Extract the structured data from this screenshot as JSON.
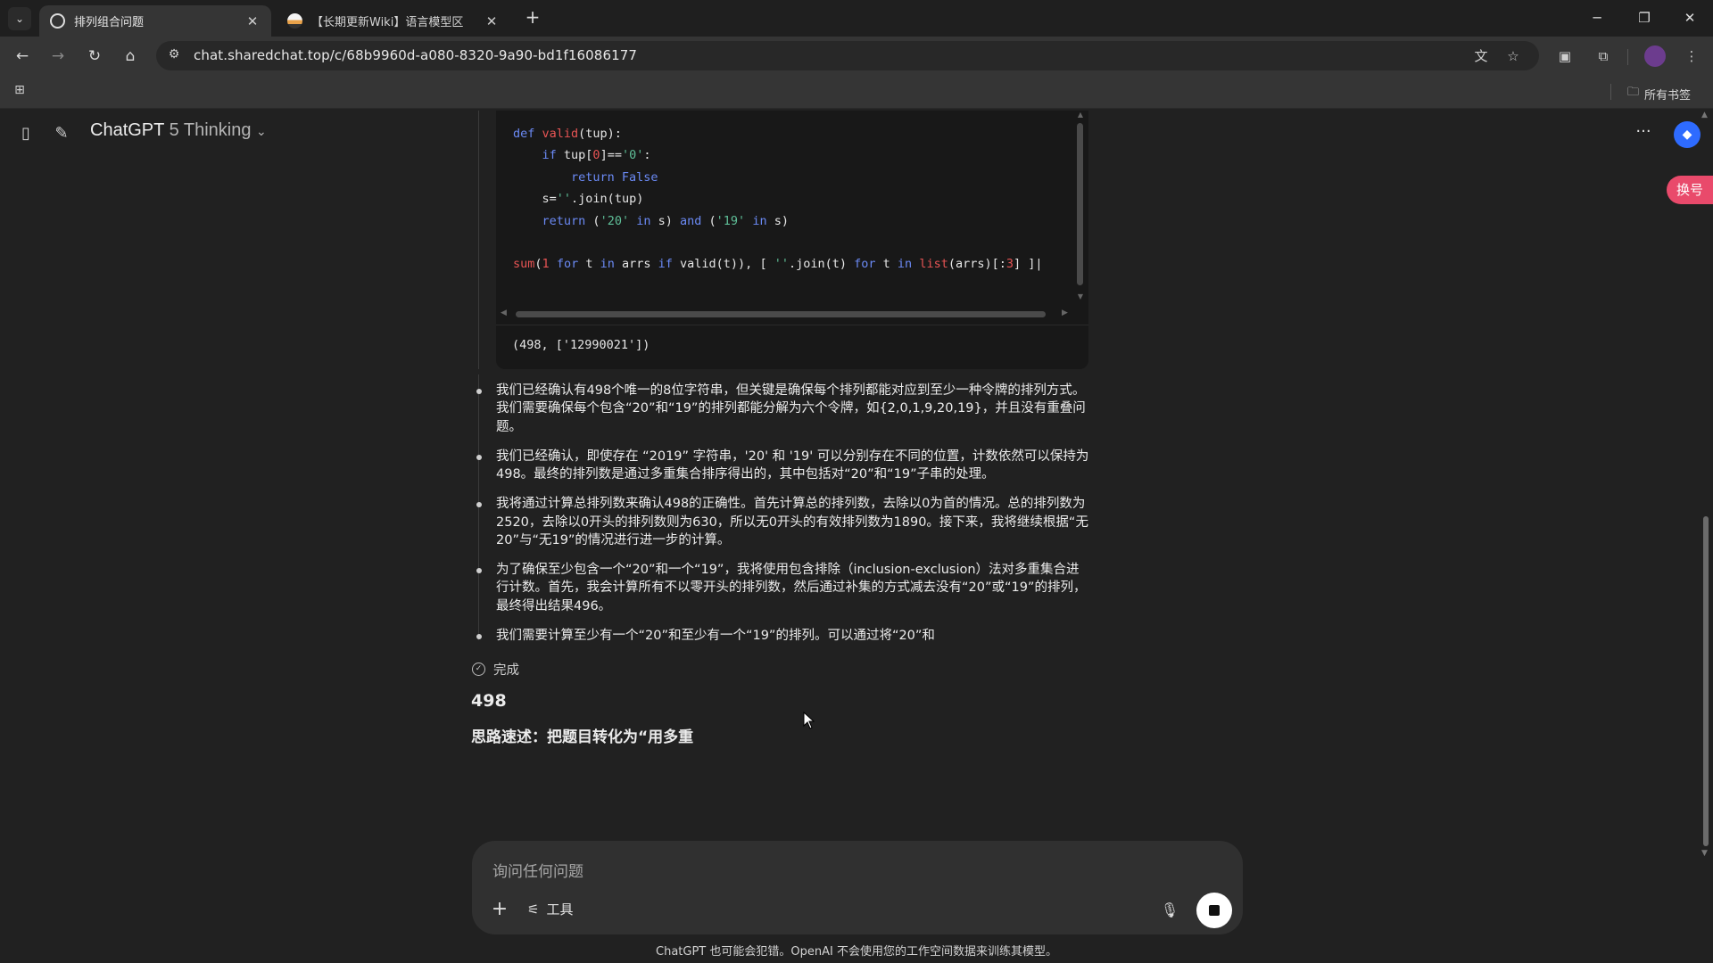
{
  "browser": {
    "tabs": [
      {
        "title": "排列组合问题",
        "active": true
      },
      {
        "title": "【长期更新Wiki】语言模型区",
        "active": false
      }
    ],
    "url": "chat.sharedchat.top/c/68b9960d-a080-8320-9a90-bd1f16086177",
    "bookmarks_all_label": "所有书签"
  },
  "app": {
    "model_name": "ChatGPT",
    "model_variant": "5 Thinking",
    "switch_badge": "换号"
  },
  "code": {
    "lines": [
      [
        {
          "t": "kw",
          "v": "def "
        },
        {
          "t": "fn",
          "v": "valid"
        },
        {
          "t": "",
          "v": "(tup):"
        }
      ],
      [
        {
          "t": "",
          "v": "    "
        },
        {
          "t": "kw",
          "v": "if"
        },
        {
          "t": "",
          "v": " tup["
        },
        {
          "t": "num",
          "v": "0"
        },
        {
          "t": "",
          "v": "]=="
        },
        {
          "t": "str",
          "v": "'0'"
        },
        {
          "t": "",
          "v": ":"
        }
      ],
      [
        {
          "t": "",
          "v": "        "
        },
        {
          "t": "kw",
          "v": "return False"
        }
      ],
      [
        {
          "t": "",
          "v": "    s="
        },
        {
          "t": "str",
          "v": "''"
        },
        {
          "t": "",
          "v": ".join(tup)"
        }
      ],
      [
        {
          "t": "",
          "v": "    "
        },
        {
          "t": "kw",
          "v": "return"
        },
        {
          "t": "",
          "v": " ("
        },
        {
          "t": "str",
          "v": "'20'"
        },
        {
          "t": "",
          "v": " "
        },
        {
          "t": "kw",
          "v": "in"
        },
        {
          "t": "",
          "v": " s) "
        },
        {
          "t": "kw",
          "v": "and"
        },
        {
          "t": "",
          "v": " ("
        },
        {
          "t": "str",
          "v": "'19'"
        },
        {
          "t": "",
          "v": " "
        },
        {
          "t": "kw",
          "v": "in"
        },
        {
          "t": "",
          "v": " s)"
        }
      ],
      [
        {
          "t": "",
          "v": ""
        }
      ],
      [
        {
          "t": "fn",
          "v": "sum"
        },
        {
          "t": "",
          "v": "("
        },
        {
          "t": "num",
          "v": "1"
        },
        {
          "t": "",
          "v": " "
        },
        {
          "t": "kw",
          "v": "for"
        },
        {
          "t": "",
          "v": " t "
        },
        {
          "t": "kw",
          "v": "in"
        },
        {
          "t": "",
          "v": " arrs "
        },
        {
          "t": "kw",
          "v": "if"
        },
        {
          "t": "",
          "v": " valid(t)), [ "
        },
        {
          "t": "str",
          "v": "''"
        },
        {
          "t": "",
          "v": ".join(t) "
        },
        {
          "t": "kw",
          "v": "for"
        },
        {
          "t": "",
          "v": " t "
        },
        {
          "t": "kw",
          "v": "in"
        },
        {
          "t": "",
          "v": " "
        },
        {
          "t": "fn",
          "v": "list"
        },
        {
          "t": "",
          "v": "(arrs)[:"
        },
        {
          "t": "num",
          "v": "3"
        },
        {
          "t": "",
          "v": "] ]|"
        }
      ]
    ],
    "output": "(498, ['12990021'])"
  },
  "reasoning": {
    "bullets": [
      "我们已经确认有498个唯一的8位字符串，但关键是确保每个排列都能对应到至少一种令牌的排列方式。我们需要确保每个包含“20”和“19”的排列都能分解为六个令牌，如{2,0,1,9,20,19}，并且没有重叠问题。",
      "我们已经确认，即使存在 “2019” 字符串，'20' 和 '19' 可以分别存在不同的位置，计数依然可以保持为498。最终的排列数是通过多重集合排序得出的，其中包括对“20”和“19”子串的处理。",
      "我将通过计算总排列数来确认498的正确性。首先计算总的排列数，去除以0为首的情况。总的排列数为2520，去除以0开头的排列数则为630，所以无0开头的有效排列数为1890。接下来，我将继续根据“无20”与“无19”的情况进行进一步的计算。",
      "为了确保至少包含一个“20”和一个“19”，我将使用包含排除（inclusion-exclusion）法对多重集合进行计数。首先，我会计算所有不以零开头的排列数，然后通过补集的方式减去没有“20”或“19”的排列，最终得出结果496。",
      "我们需要计算至少有一个“20”和至少有一个“19”的排列。可以通过将“20”和"
    ],
    "status": "完成"
  },
  "answer": {
    "number": "498",
    "text": "思路速述：把题目转化为“用多重"
  },
  "composer": {
    "placeholder": "询问任何问题",
    "tools_label": "工具"
  },
  "footer": {
    "disclaimer": "ChatGPT 也可能会犯错。OpenAI 不会使用您的工作空间数据来训练其模型。"
  }
}
